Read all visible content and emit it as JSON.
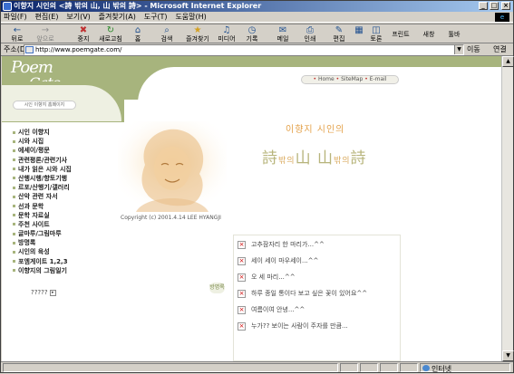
{
  "window": {
    "title": "이향지 시인의 <詩 밖의 山, 山 밖의 詩> - Microsoft Internet Explorer",
    "controls": [
      "_",
      "□",
      "×"
    ]
  },
  "menubar": [
    "파일(F)",
    "편집(E)",
    "보기(V)",
    "즐겨찾기(A)",
    "도구(T)",
    "도움말(H)"
  ],
  "toolbar": [
    {
      "label": "뒤로",
      "icon": "back-icon",
      "glyph": "←"
    },
    {
      "label": "앞으로",
      "icon": "forward-icon",
      "glyph": "→"
    },
    {
      "label": "중지",
      "icon": "stop-icon",
      "glyph": "✖"
    },
    {
      "label": "새로고침",
      "icon": "refresh-icon",
      "glyph": "↻"
    },
    {
      "label": "홈",
      "icon": "home-icon",
      "glyph": "⌂"
    },
    {
      "label": "검색",
      "icon": "search-icon",
      "glyph": "⌕"
    },
    {
      "label": "즐겨찾기",
      "icon": "favorites-icon",
      "glyph": "★"
    },
    {
      "label": "미디어",
      "icon": "media-icon",
      "glyph": "♫"
    },
    {
      "label": "기록",
      "icon": "history-icon",
      "glyph": "◷"
    },
    {
      "label": "메일",
      "icon": "mail-icon",
      "glyph": "✉"
    },
    {
      "label": "인쇄",
      "icon": "print-icon",
      "glyph": "⎙"
    },
    {
      "label": "편집",
      "icon": "edit-icon",
      "glyph": "✎"
    },
    {
      "label": "",
      "icon": "discuss-icon",
      "glyph": "▦"
    },
    {
      "label": "토론",
      "icon": "discuss-icon",
      "glyph": "◫"
    },
    {
      "label": "프린트",
      "icon": "",
      "glyph": ""
    },
    {
      "label": "새창",
      "icon": "",
      "glyph": ""
    },
    {
      "label": "툴바",
      "icon": "",
      "glyph": ""
    }
  ],
  "address": {
    "label": "주소(D)",
    "url": "http://www.poemgate.com/",
    "go": "이동",
    "links": "연결 »"
  },
  "site": {
    "logo_line1": "Poem",
    "logo_line2": "Gate",
    "topnav": [
      {
        "label": "Home"
      },
      {
        "label": "SiteMap"
      },
      {
        "label": "E-mail"
      }
    ],
    "sidebar_header": "시인 이향지 홈페이지",
    "menu": [
      "시인 이향지",
      "시와 시집",
      "에세이/평문",
      "관련평론/관련기사",
      "내가 읽은 시와 시집",
      "산행시행/향토기행",
      "르포/산행기/갤러리",
      "산악 관련 자서",
      "선과 문학",
      "문학 자료실",
      "주천 사이트",
      "글마루/그림마루",
      "방명록",
      "시인의 육성",
      "포엠게이트 1,2,3",
      "이향지의 그림일기"
    ],
    "bottom_link": "?????",
    "copyright": "Copyright (c) 2001.4.14  LEE HYANGJI",
    "poet_title": "이향지 시인의",
    "poem_title": {
      "a": "詩",
      "b": "밖의",
      "c": "山",
      "d": "山",
      "e": "밖의",
      "f": "詩"
    },
    "guestbook_label": "방명록",
    "guestbook": [
      "고추잠자리 한 마리가...^^",
      "세이 세이 마우세이...^^",
      "오 세 마리...^^",
      "하루 종일 통이다 보고 싶은 꽃이 있어요^^",
      "여름이여 안녕...^^",
      "누가?? 보이는 사람이 주자를 만큼..."
    ]
  },
  "status": {
    "text": "",
    "zone": "인터넷"
  },
  "colors": {
    "olive": "#a7b47d",
    "title_orange": "#e4a24b",
    "title_olive": "#b7b47b"
  }
}
